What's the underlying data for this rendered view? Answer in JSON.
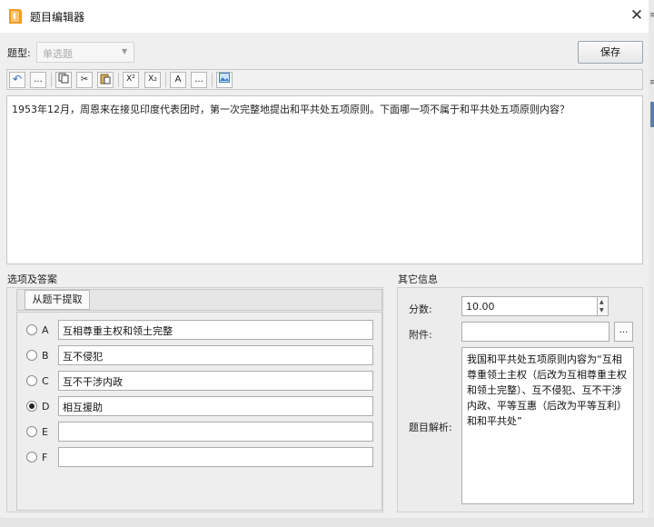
{
  "window": {
    "title": "题目编辑器",
    "close_glyph": "✕",
    "app_icon": "orange-book-icon"
  },
  "type_row": {
    "label": "题型:",
    "select_value": "单选题",
    "save_label": "保存"
  },
  "toolbar": {
    "buttons": [
      {
        "icon": "undo-icon",
        "glyph": "↶"
      },
      {
        "icon": "more-icon",
        "glyph": "..."
      },
      {
        "icon": "copy-icon",
        "glyph": "⎘"
      },
      {
        "icon": "cut-icon",
        "glyph": "✂"
      },
      {
        "icon": "paste-icon",
        "glyph": "📋"
      },
      {
        "icon": "superscript-icon",
        "glyph": "X²"
      },
      {
        "icon": "subscript-icon",
        "glyph": "X₂"
      },
      {
        "icon": "font-icon",
        "glyph": "A"
      },
      {
        "icon": "more-font-icon",
        "glyph": "..."
      },
      {
        "icon": "image-icon",
        "glyph": "▣"
      }
    ]
  },
  "question": {
    "text": "1953年12月，周恩来在接见印度代表团时，第一次完整地提出和平共处五项原则。下面哪一项不属于和平共处五项原则内容？"
  },
  "options_section": {
    "header": "选项及答案",
    "extract_label": "从题干提取",
    "options": [
      {
        "letter": "A",
        "text": "互相尊重主权和领土完整",
        "selected": false
      },
      {
        "letter": "B",
        "text": "互不侵犯",
        "selected": false
      },
      {
        "letter": "C",
        "text": "互不干涉内政",
        "selected": false
      },
      {
        "letter": "D",
        "text": "相互援助",
        "selected": true
      },
      {
        "letter": "E",
        "text": "",
        "selected": false
      },
      {
        "letter": "F",
        "text": "",
        "selected": false
      }
    ]
  },
  "other_section": {
    "header": "其它信息",
    "score_label": "分数:",
    "score_value": "10.00",
    "attach_label": "附件:",
    "attach_value": "",
    "attach_button": "...",
    "analysis_label": "题目解析:",
    "analysis_text": "我国和平共处五项原则内容为“互相尊重领土主权（后改为互相尊重主权和领土完整）、互不侵犯、互不干涉内政、平等互惠（后改为平等互利）和和平共处”"
  }
}
